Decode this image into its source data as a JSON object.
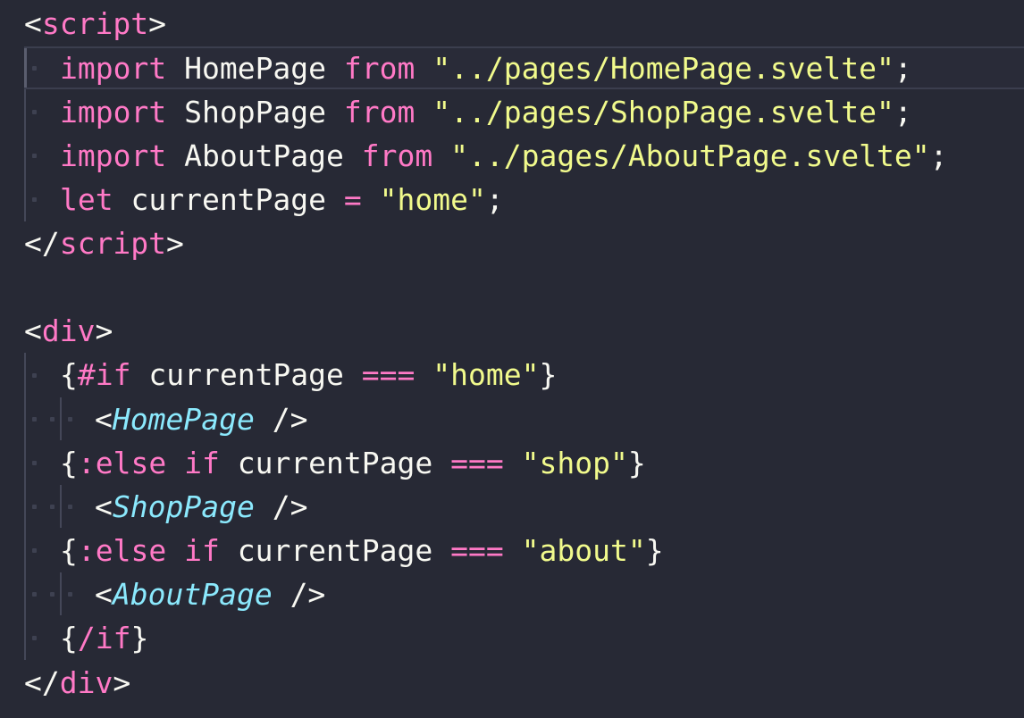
{
  "editor": {
    "language": "svelte",
    "theme_colors": {
      "background": "#272935",
      "tag": "#ff79c6",
      "keyword": "#ff79c6",
      "string": "#f1fa8c",
      "component": "#8be9fd",
      "plain": "#f8f8f2"
    },
    "lines": [
      {
        "open_bracket": "<",
        "tag": "script",
        "close_bracket": ">"
      },
      {
        "kw_import": "import",
        "name": "HomePage",
        "kw_from": "from",
        "path": "\"../pages/HomePage.svelte\"",
        "semi": ";"
      },
      {
        "kw_import": "import",
        "name": "ShopPage",
        "kw_from": "from",
        "path": "\"../pages/ShopPage.svelte\"",
        "semi": ";"
      },
      {
        "kw_import": "import",
        "name": "AboutPage",
        "kw_from": "from",
        "path": "\"../pages/AboutPage.svelte\"",
        "semi": ";"
      },
      {
        "kw_let": "let",
        "name": "currentPage",
        "op": "=",
        "value": "\"home\"",
        "semi": ";"
      },
      {
        "open_bracket": "</",
        "tag": "script",
        "close_bracket": ">"
      },
      {
        "empty": ""
      },
      {
        "open_bracket": "<",
        "tag": "div",
        "close_bracket": ">"
      },
      {
        "brace_open": "{",
        "kw": "#if",
        "name": "currentPage",
        "op": "===",
        "value": "\"home\"",
        "brace_close": "}"
      },
      {
        "open_bracket": "<",
        "component": "HomePage",
        "close": "/>"
      },
      {
        "brace_open": "{",
        "kw": ":else if",
        "name": "currentPage",
        "op": "===",
        "value": "\"shop\"",
        "brace_close": "}"
      },
      {
        "open_bracket": "<",
        "component": "ShopPage",
        "close": "/>"
      },
      {
        "brace_open": "{",
        "kw": ":else if",
        "name": "currentPage",
        "op": "===",
        "value": "\"about\"",
        "brace_close": "}"
      },
      {
        "open_bracket": "<",
        "component": "AboutPage",
        "close": "/>"
      },
      {
        "brace_open": "{",
        "kw": "/if",
        "brace_close": "}"
      },
      {
        "open_bracket": "</",
        "tag": "div",
        "close_bracket": ">"
      }
    ]
  }
}
